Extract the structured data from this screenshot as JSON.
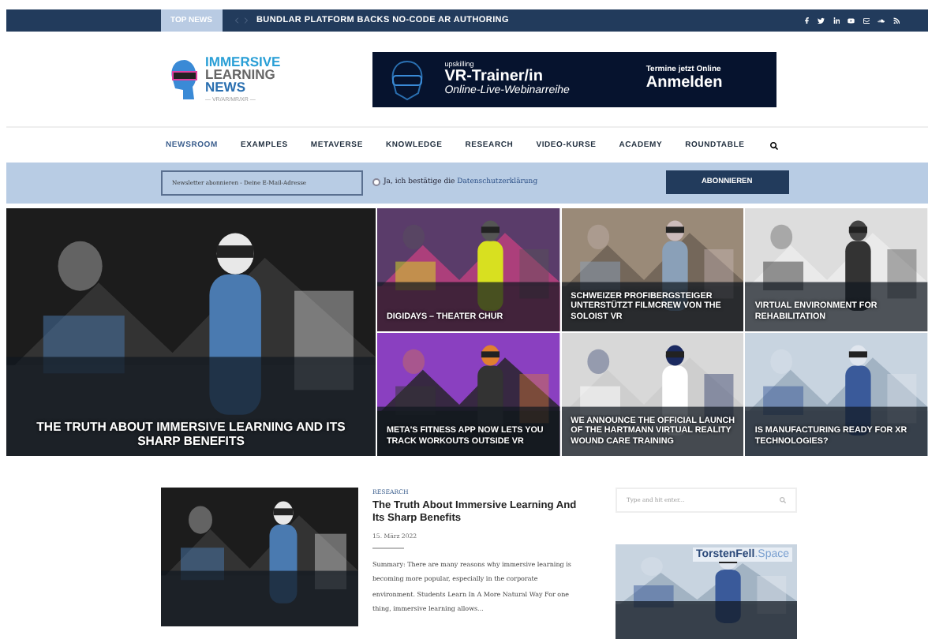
{
  "top_bar": {
    "label": "TOP NEWS",
    "headline": "BUNDLAR PLATFORM BACKS NO-CODE AR AUTHORING"
  },
  "logo": {
    "lines": [
      "IMMERSIVE",
      "LEARNING",
      "NEWS"
    ],
    "tagline": "— VR/AR/MR/XR —"
  },
  "banner": {
    "kicker": "upskilling",
    "title": "VR-Trainer/in",
    "subtitle": "Online-Live-Webinarreihe",
    "note": "Termine jetzt Online",
    "cta": "Anmelden"
  },
  "nav": [
    {
      "label": "NEWSROOM",
      "selected": true
    },
    {
      "label": "EXAMPLES",
      "selected": false
    },
    {
      "label": "METAVERSE",
      "selected": false
    },
    {
      "label": "KNOWLEDGE",
      "selected": false
    },
    {
      "label": "RESEARCH",
      "selected": false
    },
    {
      "label": "VIDEO-KURSE",
      "selected": false
    },
    {
      "label": "ACADEMY",
      "selected": false
    },
    {
      "label": "ROUNDTABLE",
      "selected": false
    }
  ],
  "newsletter": {
    "placeholder": "Newsletter abonnieren - Deine E-Mail-Adresse",
    "consent": "Ja, ich bestätige die",
    "consent_link": "Datenschutzerklärung",
    "checked": false,
    "button": "ABONNIEREN"
  },
  "tiles": [
    {
      "title": "THE TRUTH ABOUT IMMERSIVE LEARNING AND ITS SHARP BENEFITS"
    },
    {
      "title": "DIGIDAYS – THEATER CHUR"
    },
    {
      "title": "SCHWEIZER PROFIBERGSTEIGER UNTERSTÜTZT FILMCREW VON THE SOLOIST VR"
    },
    {
      "title": "VIRTUAL ENVIRONMENT FOR REHABILITATION"
    },
    {
      "title": "META'S FITNESS APP NOW LETS YOU TRACK WORKOUTS OUTSIDE VR"
    },
    {
      "title": "WE ANNOUNCE THE OFFICIAL LAUNCH OF THE HARTMANN VIRTUAL REALITY WOUND CARE TRAINING"
    },
    {
      "title": "IS MANUFACTURING READY FOR XR TECHNOLOGIES?"
    }
  ],
  "article": {
    "category": "RESEARCH",
    "title": "The Truth About Immersive Learning And Its Sharp Benefits",
    "date": "15. März 2022",
    "summary": "Summary: There are many reasons why immersive learning is becoming more popular, especially in the corporate environment. Students Learn In A More Natural Way For one thing, immersive learning allows..."
  },
  "sidebar": {
    "search_placeholder": "Type and hit enter...",
    "ad_title": "TorstenFell",
    "ad_suffix": ".Space"
  }
}
